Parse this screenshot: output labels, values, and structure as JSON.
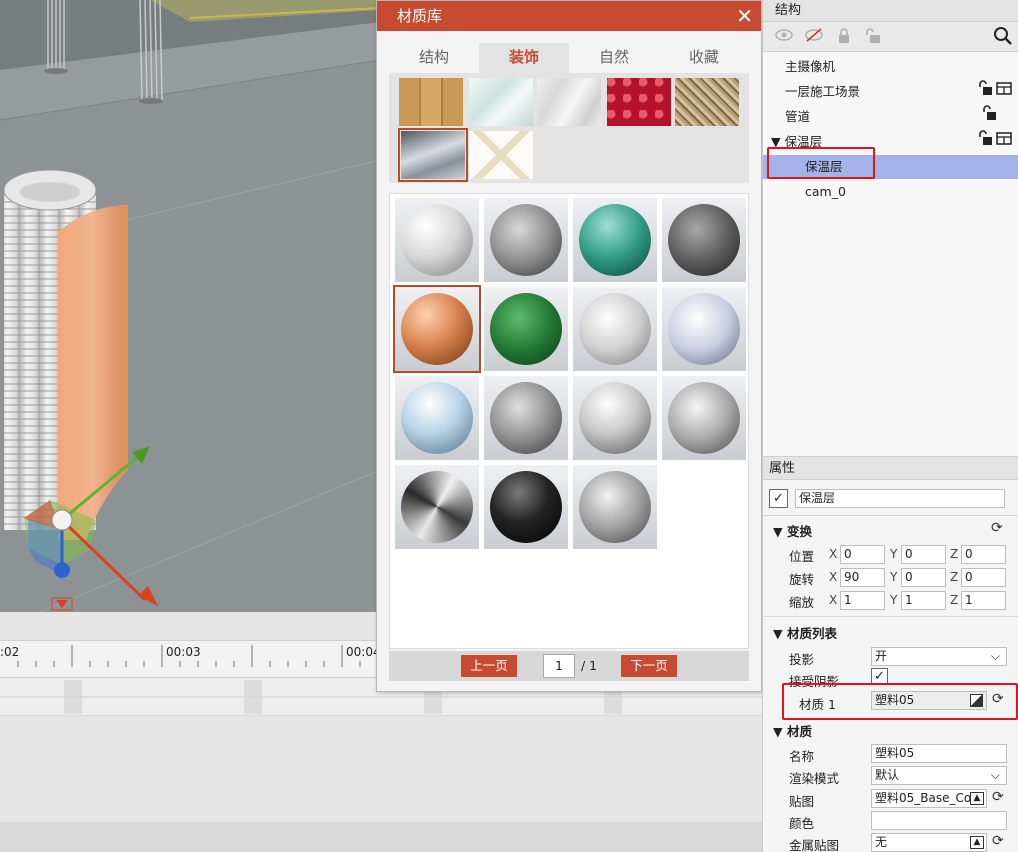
{
  "dialog": {
    "title": "材质库",
    "close_symbol": "✕",
    "tabs": [
      "结构",
      "装饰",
      "自然",
      "收藏"
    ],
    "active_tab": "装饰",
    "pager": {
      "prev": "上一页",
      "next": "下一页",
      "current": "1",
      "total": "/ 1"
    },
    "thumbnails": [
      {
        "name": "wood-floor-thumbnail"
      },
      {
        "name": "glass-thumbnail"
      },
      {
        "name": "marble-thumbnail"
      },
      {
        "name": "red-fabric-thumbnail"
      },
      {
        "name": "carpet-thumbnail"
      },
      {
        "name": "tile-thumbnail"
      },
      {
        "name": "ceiling-pattern-thumbnail"
      }
    ]
  },
  "timeline": {
    "labels": [
      ":02",
      "00:03",
      "00:04"
    ]
  },
  "structure": {
    "title": "结构",
    "tools": [
      "eye-icon",
      "hide-icon",
      "lock-icon",
      "unlock-icon"
    ],
    "search_icon": "search-icon",
    "nodes": [
      {
        "label": "主摄像机",
        "indent": 0
      },
      {
        "label": "一层施工场景",
        "indent": 0
      },
      {
        "label": "管道",
        "indent": 0
      },
      {
        "label": "▼ 保温层",
        "indent": 0
      },
      {
        "label": "保温层",
        "indent": 2
      },
      {
        "label": "cam_0",
        "indent": 2
      }
    ]
  },
  "properties": {
    "title": "属性",
    "name_value": "保温层",
    "transform": {
      "title": "▼ 变换",
      "position": {
        "label": "位置",
        "x": "0",
        "y": "0",
        "z": "0"
      },
      "rotation": {
        "label": "旋转",
        "x": "90",
        "y": "0",
        "z": "0"
      },
      "scale": {
        "label": "缩放",
        "x": "1",
        "y": "1",
        "z": "1"
      }
    },
    "material_list": {
      "title": "▼ 材质列表",
      "cast_shadow": {
        "label": "投影",
        "value": "开"
      },
      "receive_shadow": {
        "label": "接受阴影"
      },
      "material1": {
        "label": "材质 1",
        "value": "塑料05"
      }
    },
    "material": {
      "title": "▼ 材质",
      "name": {
        "label": "名称",
        "value": "塑料05"
      },
      "render_mode": {
        "label": "渲染模式",
        "value": "默认"
      },
      "texture": {
        "label": "贴图",
        "value": "塑料05_Base_Co"
      },
      "color": {
        "label": "颜色"
      },
      "metal_map": {
        "label": "金属贴图",
        "value": "无"
      }
    }
  },
  "colors": {
    "accent": "#c74b31",
    "selection": "#a3b3ea",
    "highlight": "#e0141c"
  }
}
